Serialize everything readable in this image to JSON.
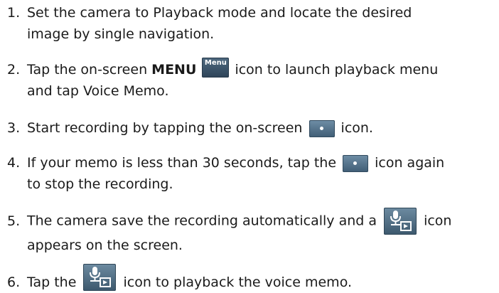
{
  "steps": [
    {
      "num": "1.",
      "line1": "Set the camera to Playback mode and locate the desired",
      "line2": "image by single navigation."
    },
    {
      "num": "2.",
      "pre": "Tap the on-screen ",
      "bold": "MENU",
      "post": " icon to launch playback menu",
      "line2": "and tap Voice Memo.",
      "icon_label": "Menu",
      "icon": "menu-icon"
    },
    {
      "num": "3.",
      "pre": "Start recording by tapping the on-screen ",
      "post": " icon.",
      "icon": "record-icon"
    },
    {
      "num": "4.",
      "pre": "If your memo is less than 30 seconds, tap the ",
      "post": " icon again",
      "line2": "to stop the recording.",
      "icon": "record-icon"
    },
    {
      "num": "5.",
      "pre": "The camera save the recording automatically and a ",
      "post": " icon",
      "line2": "appears on the screen.",
      "icon": "voice-memo-icon"
    },
    {
      "num": "6.",
      "pre": "Tap the ",
      "post": " icon to playback the voice memo.",
      "icon": "voice-memo-icon"
    }
  ]
}
